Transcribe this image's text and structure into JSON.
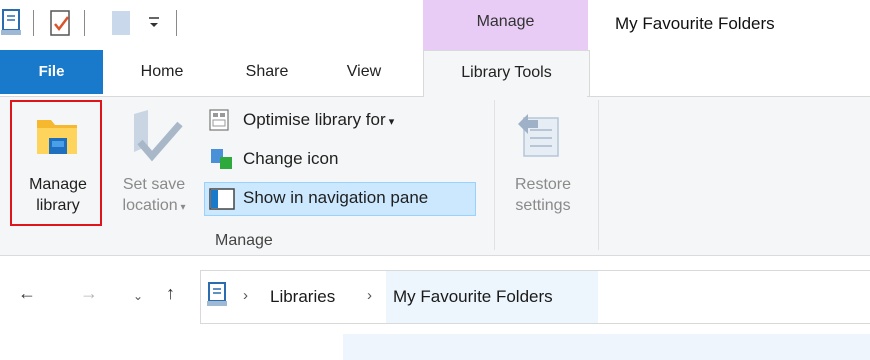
{
  "window": {
    "title": "My Favourite Folders",
    "context_tab_group": "Manage"
  },
  "tabs": [
    "File",
    "Home",
    "Share",
    "View",
    "Library Tools"
  ],
  "ribbon": {
    "manage_library": {
      "line1": "Manage",
      "line2": "library"
    },
    "set_save_location": {
      "line1": "Set save",
      "line2": "location"
    },
    "optimise_library": "Optimise library for",
    "change_icon": "Change icon",
    "show_in_nav_pane": "Show in navigation pane",
    "restore_settings": {
      "line1": "Restore",
      "line2": "settings"
    },
    "group_label": "Manage"
  },
  "address": {
    "crumbs": [
      "Libraries",
      "My Favourite Folders"
    ]
  },
  "colors": {
    "file_tab": "#1979ca",
    "context_tab": "#e8ccf5",
    "highlight": "#e0141b",
    "selected": "#cce8ff"
  }
}
